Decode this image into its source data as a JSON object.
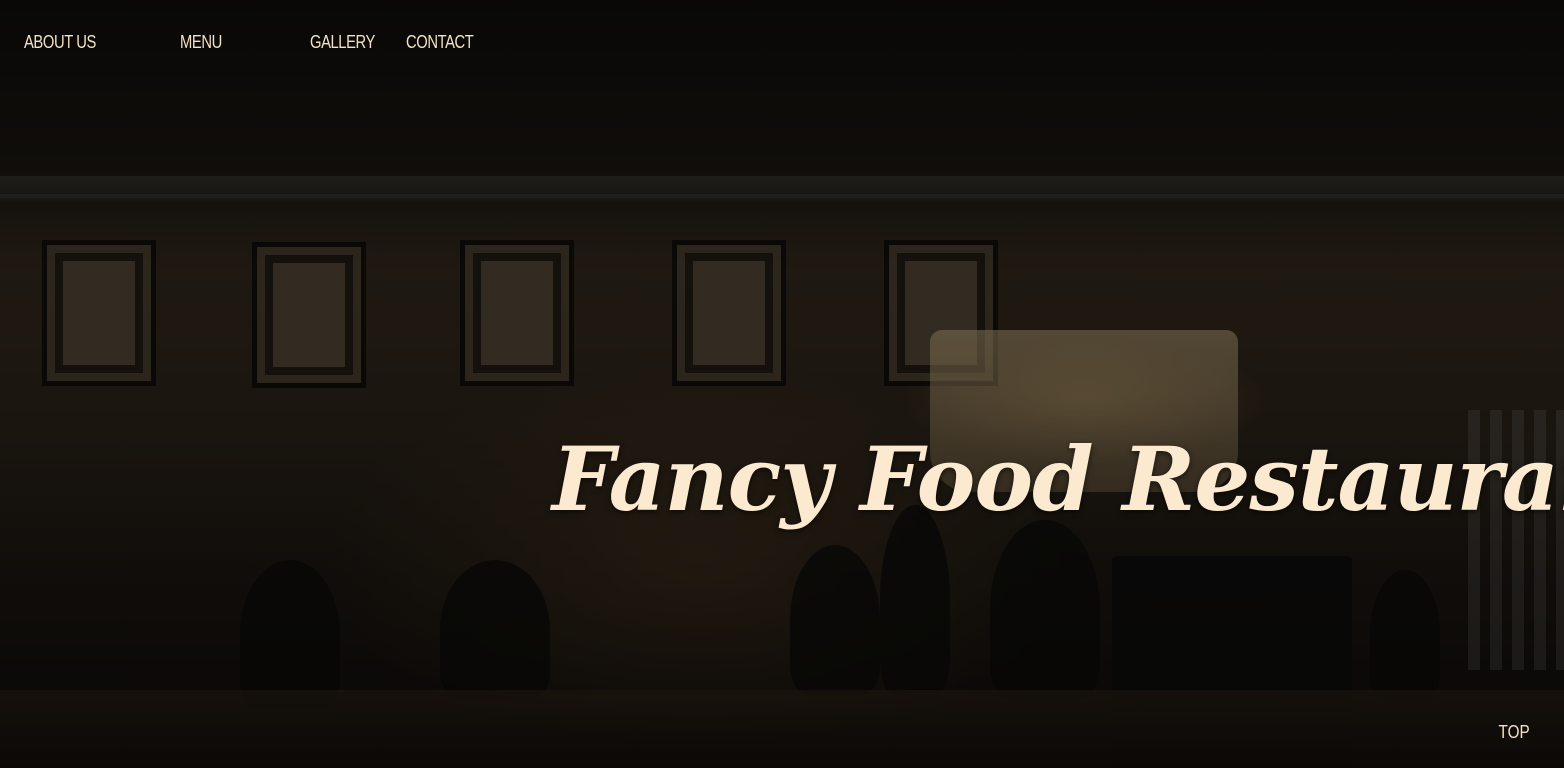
{
  "nav": {
    "about_label": "ABOUT US",
    "menu_label": "MENU",
    "gallery_label": "GALLERY",
    "contact_label": "CONTACT"
  },
  "hero": {
    "title": "Fancy Food Restaurant"
  },
  "footer": {
    "top_label": "TOP"
  },
  "colors": {
    "text": "#f3e2c4",
    "title": "#fbe9d0",
    "background": "#1a1510"
  }
}
